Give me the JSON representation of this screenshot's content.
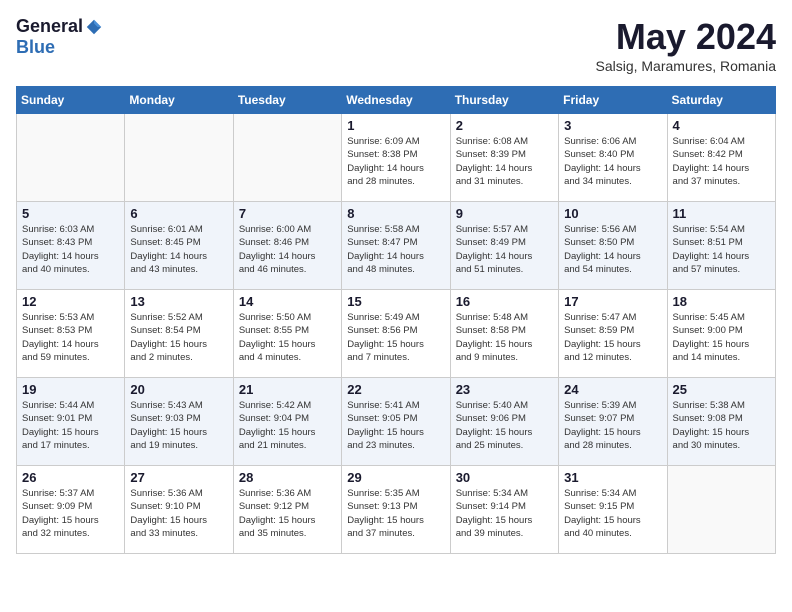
{
  "logo": {
    "general": "General",
    "blue": "Blue"
  },
  "title": "May 2024",
  "location": "Salsig, Maramures, Romania",
  "days_of_week": [
    "Sunday",
    "Monday",
    "Tuesday",
    "Wednesday",
    "Thursday",
    "Friday",
    "Saturday"
  ],
  "weeks": [
    [
      {
        "day": "",
        "info": ""
      },
      {
        "day": "",
        "info": ""
      },
      {
        "day": "",
        "info": ""
      },
      {
        "day": "1",
        "info": "Sunrise: 6:09 AM\nSunset: 8:38 PM\nDaylight: 14 hours\nand 28 minutes."
      },
      {
        "day": "2",
        "info": "Sunrise: 6:08 AM\nSunset: 8:39 PM\nDaylight: 14 hours\nand 31 minutes."
      },
      {
        "day": "3",
        "info": "Sunrise: 6:06 AM\nSunset: 8:40 PM\nDaylight: 14 hours\nand 34 minutes."
      },
      {
        "day": "4",
        "info": "Sunrise: 6:04 AM\nSunset: 8:42 PM\nDaylight: 14 hours\nand 37 minutes."
      }
    ],
    [
      {
        "day": "5",
        "info": "Sunrise: 6:03 AM\nSunset: 8:43 PM\nDaylight: 14 hours\nand 40 minutes."
      },
      {
        "day": "6",
        "info": "Sunrise: 6:01 AM\nSunset: 8:45 PM\nDaylight: 14 hours\nand 43 minutes."
      },
      {
        "day": "7",
        "info": "Sunrise: 6:00 AM\nSunset: 8:46 PM\nDaylight: 14 hours\nand 46 minutes."
      },
      {
        "day": "8",
        "info": "Sunrise: 5:58 AM\nSunset: 8:47 PM\nDaylight: 14 hours\nand 48 minutes."
      },
      {
        "day": "9",
        "info": "Sunrise: 5:57 AM\nSunset: 8:49 PM\nDaylight: 14 hours\nand 51 minutes."
      },
      {
        "day": "10",
        "info": "Sunrise: 5:56 AM\nSunset: 8:50 PM\nDaylight: 14 hours\nand 54 minutes."
      },
      {
        "day": "11",
        "info": "Sunrise: 5:54 AM\nSunset: 8:51 PM\nDaylight: 14 hours\nand 57 minutes."
      }
    ],
    [
      {
        "day": "12",
        "info": "Sunrise: 5:53 AM\nSunset: 8:53 PM\nDaylight: 14 hours\nand 59 minutes."
      },
      {
        "day": "13",
        "info": "Sunrise: 5:52 AM\nSunset: 8:54 PM\nDaylight: 15 hours\nand 2 minutes."
      },
      {
        "day": "14",
        "info": "Sunrise: 5:50 AM\nSunset: 8:55 PM\nDaylight: 15 hours\nand 4 minutes."
      },
      {
        "day": "15",
        "info": "Sunrise: 5:49 AM\nSunset: 8:56 PM\nDaylight: 15 hours\nand 7 minutes."
      },
      {
        "day": "16",
        "info": "Sunrise: 5:48 AM\nSunset: 8:58 PM\nDaylight: 15 hours\nand 9 minutes."
      },
      {
        "day": "17",
        "info": "Sunrise: 5:47 AM\nSunset: 8:59 PM\nDaylight: 15 hours\nand 12 minutes."
      },
      {
        "day": "18",
        "info": "Sunrise: 5:45 AM\nSunset: 9:00 PM\nDaylight: 15 hours\nand 14 minutes."
      }
    ],
    [
      {
        "day": "19",
        "info": "Sunrise: 5:44 AM\nSunset: 9:01 PM\nDaylight: 15 hours\nand 17 minutes."
      },
      {
        "day": "20",
        "info": "Sunrise: 5:43 AM\nSunset: 9:03 PM\nDaylight: 15 hours\nand 19 minutes."
      },
      {
        "day": "21",
        "info": "Sunrise: 5:42 AM\nSunset: 9:04 PM\nDaylight: 15 hours\nand 21 minutes."
      },
      {
        "day": "22",
        "info": "Sunrise: 5:41 AM\nSunset: 9:05 PM\nDaylight: 15 hours\nand 23 minutes."
      },
      {
        "day": "23",
        "info": "Sunrise: 5:40 AM\nSunset: 9:06 PM\nDaylight: 15 hours\nand 25 minutes."
      },
      {
        "day": "24",
        "info": "Sunrise: 5:39 AM\nSunset: 9:07 PM\nDaylight: 15 hours\nand 28 minutes."
      },
      {
        "day": "25",
        "info": "Sunrise: 5:38 AM\nSunset: 9:08 PM\nDaylight: 15 hours\nand 30 minutes."
      }
    ],
    [
      {
        "day": "26",
        "info": "Sunrise: 5:37 AM\nSunset: 9:09 PM\nDaylight: 15 hours\nand 32 minutes."
      },
      {
        "day": "27",
        "info": "Sunrise: 5:36 AM\nSunset: 9:10 PM\nDaylight: 15 hours\nand 33 minutes."
      },
      {
        "day": "28",
        "info": "Sunrise: 5:36 AM\nSunset: 9:12 PM\nDaylight: 15 hours\nand 35 minutes."
      },
      {
        "day": "29",
        "info": "Sunrise: 5:35 AM\nSunset: 9:13 PM\nDaylight: 15 hours\nand 37 minutes."
      },
      {
        "day": "30",
        "info": "Sunrise: 5:34 AM\nSunset: 9:14 PM\nDaylight: 15 hours\nand 39 minutes."
      },
      {
        "day": "31",
        "info": "Sunrise: 5:34 AM\nSunset: 9:15 PM\nDaylight: 15 hours\nand 40 minutes."
      },
      {
        "day": "",
        "info": ""
      }
    ]
  ]
}
